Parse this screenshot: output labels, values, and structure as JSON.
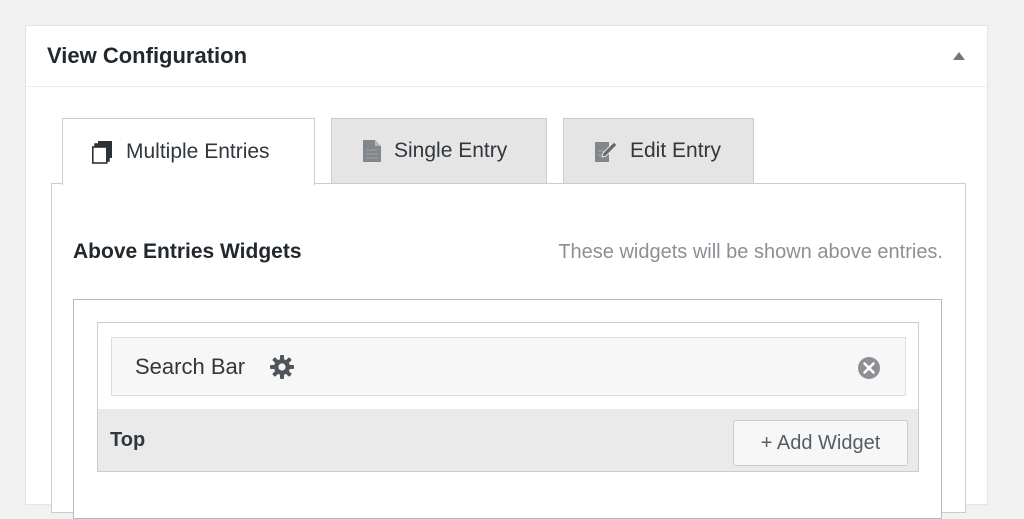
{
  "panel": {
    "title": "View Configuration"
  },
  "tabs": [
    {
      "label": "Multiple Entries",
      "active": true,
      "icon": "multiple-entries-icon"
    },
    {
      "label": "Single Entry",
      "active": false,
      "icon": "document-icon"
    },
    {
      "label": "Edit Entry",
      "active": false,
      "icon": "edit-document-icon"
    }
  ],
  "section": {
    "title": "Above Entries Widgets",
    "description": "These widgets will be shown above entries."
  },
  "area": {
    "widget_label": "Search Bar",
    "zone_label": "Top",
    "add_button_label": "+ Add Widget"
  },
  "colors": {
    "panel_bg": "#ffffff",
    "page_bg": "#f1f1f1",
    "inactive_tab_bg": "#e5e5e5",
    "muted_text": "#8c8f94"
  }
}
